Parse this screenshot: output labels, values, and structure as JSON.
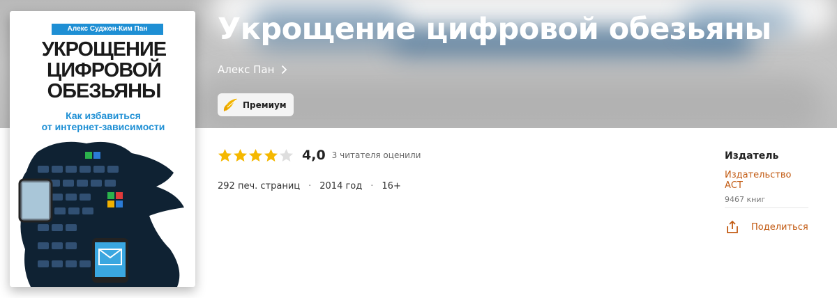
{
  "book": {
    "title": "Укрощение цифровой обезьяны",
    "author": "Алекс Пан",
    "premium_label": "Премиум"
  },
  "cover": {
    "author_line": "Алекс Суджон-Ким Пан",
    "title_line1": "УКРОЩЕНИЕ",
    "title_line2": "ЦИФРОВОЙ",
    "title_line3": "ОБЕЗЬЯНЫ",
    "subtitle_line1": "Как избавиться",
    "subtitle_line2": "от интернет-зависимости"
  },
  "rating": {
    "stars_filled": 4,
    "stars_total": 5,
    "value": "4,0",
    "count_text": "3 читателя оценили"
  },
  "meta": {
    "pages": "292 печ. страниц",
    "year": "2014 год",
    "age": "16+",
    "separator": "·"
  },
  "publisher": {
    "heading": "Издатель",
    "name": "Издательство АСТ",
    "books_count": "9467 книг",
    "share_label": "Поделиться"
  },
  "colors": {
    "accent": "#c25a12",
    "star": "#f5b800",
    "star_empty": "#dedede",
    "cover_blue": "#1e8fd4"
  }
}
